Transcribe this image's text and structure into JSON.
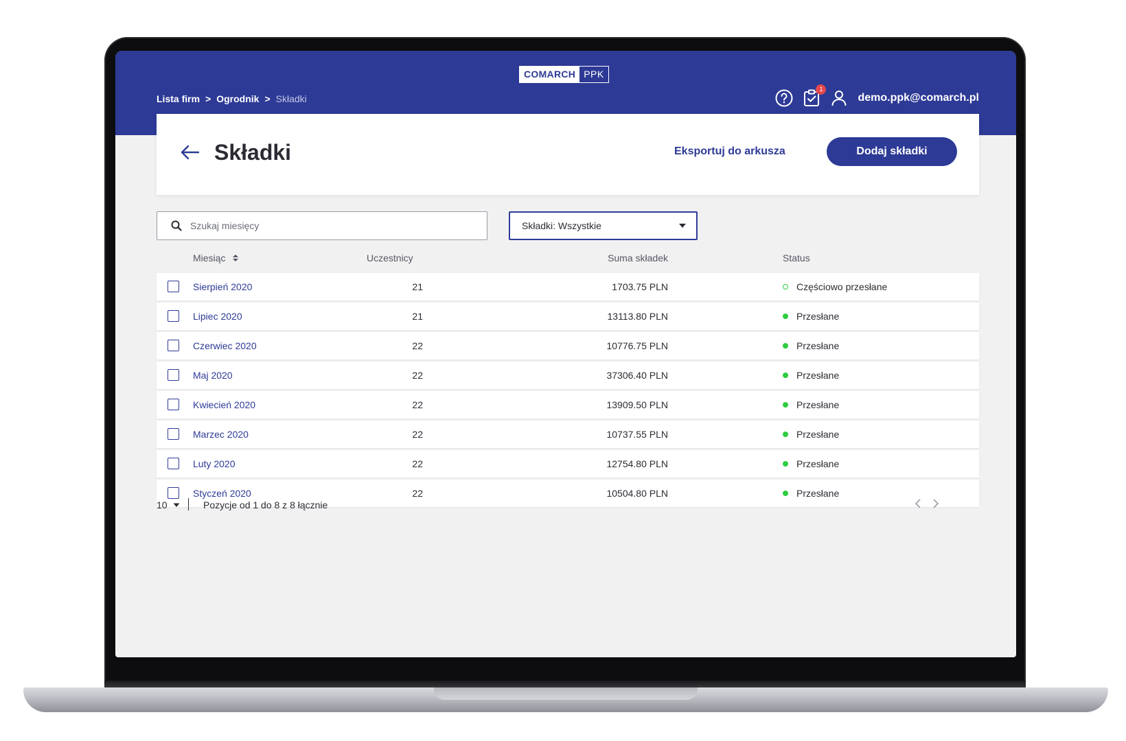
{
  "logo": {
    "left": "COMARCH",
    "right": "PPK"
  },
  "breadcrumb": {
    "items": [
      "Lista firm",
      "Ogrodnik",
      "Składki"
    ],
    "separator": ">"
  },
  "user": {
    "email": "demo.ppk@comarch.pl",
    "notification_count": "1"
  },
  "header": {
    "title": "Składki",
    "export_label": "Eksportuj do arkusza",
    "add_label": "Dodaj składki"
  },
  "search": {
    "placeholder": "Szukaj miesięcy",
    "value": ""
  },
  "filter": {
    "label": "Składki: Wszystkie"
  },
  "table": {
    "columns": {
      "month": "Miesiąc",
      "participants": "Uczestnicy",
      "sum": "Suma składek",
      "status": "Status"
    },
    "rows": [
      {
        "month": "Sierpień 2020",
        "participants": "21",
        "sum": "1703.75 PLN",
        "status": "Częściowo przesłane"
      },
      {
        "month": "Lipiec 2020",
        "participants": "21",
        "sum": "13113.80 PLN",
        "status": "Przesłane"
      },
      {
        "month": "Czerwiec 2020",
        "participants": "22",
        "sum": "10776.75 PLN",
        "status": "Przesłane"
      },
      {
        "month": "Maj 2020",
        "participants": "22",
        "sum": "37306.40 PLN",
        "status": "Przesłane"
      },
      {
        "month": "Kwiecień 2020",
        "participants": "22",
        "sum": "13909.50 PLN",
        "status": "Przesłane"
      },
      {
        "month": "Marzec 2020",
        "participants": "22",
        "sum": "10737.55 PLN",
        "status": "Przesłane"
      },
      {
        "month": "Luty 2020",
        "participants": "22",
        "sum": "12754.80 PLN",
        "status": "Przesłane"
      },
      {
        "month": "Styczeń 2020",
        "participants": "22",
        "sum": "10504.80 PLN",
        "status": "Przesłane"
      }
    ]
  },
  "pagination": {
    "page_size": "10",
    "info": "Pozycje od 1 do 8 z 8 łącznie"
  },
  "colors": {
    "brand": "#2d3a96",
    "status_ok": "#2ecc40",
    "badge": "#e5484d",
    "background": "#f1f1f2"
  },
  "icons": {
    "back": "arrow-left-icon",
    "help": "question-circle-icon",
    "tasks": "clipboard-check-icon",
    "user": "user-icon",
    "search": "search-icon",
    "dropdown": "caret-down-icon",
    "sort": "sort-icon"
  }
}
